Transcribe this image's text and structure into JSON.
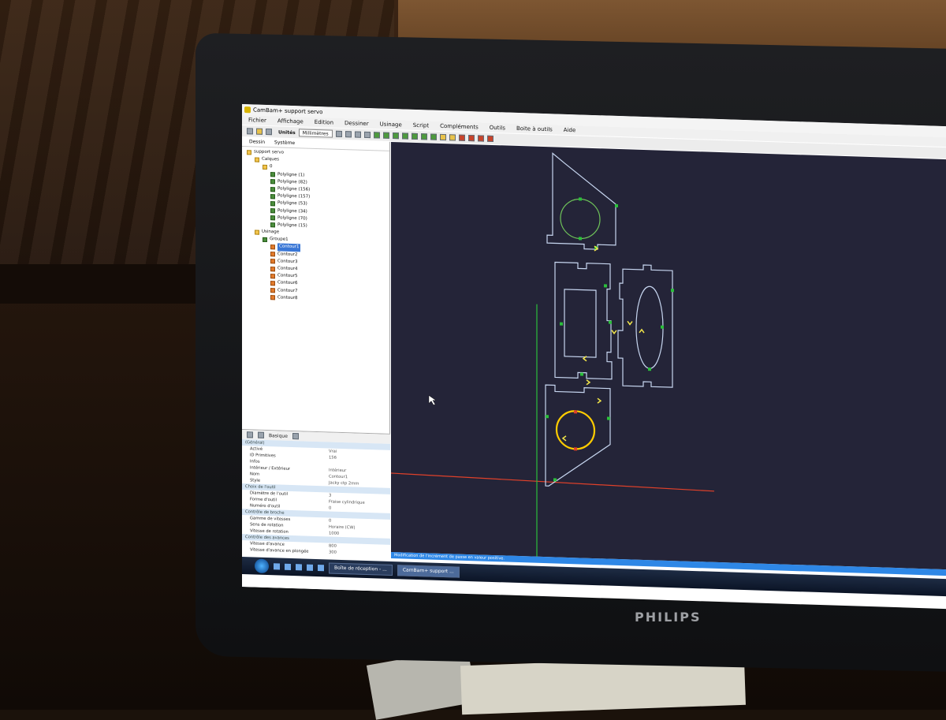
{
  "titlebar": {
    "title": "CamBam+ support servo"
  },
  "menubar": [
    "Fichier",
    "Affichage",
    "Edition",
    "Dessiner",
    "Usinage",
    "Script",
    "Compléments",
    "Outils",
    "Boite à outils",
    "Aide"
  ],
  "toolbar": {
    "units_label": "Unités",
    "units_value": "Millimètres"
  },
  "tabs": [
    "Dessin",
    "Système"
  ],
  "tree": [
    {
      "label": "support servo",
      "icon": "folder-icon",
      "level": 0
    },
    {
      "label": "Calques",
      "icon": "folder-icon",
      "level": 1
    },
    {
      "label": "0",
      "icon": "layer-icon",
      "level": 2
    },
    {
      "label": "Polyligne (1)",
      "icon": "polyline-icon",
      "level": 3
    },
    {
      "label": "Polyligne (82)",
      "icon": "polyline-icon",
      "level": 3
    },
    {
      "label": "Polyligne (156)",
      "icon": "polyline-icon",
      "level": 3
    },
    {
      "label": "Polyligne (157)",
      "icon": "polyline-icon",
      "level": 3
    },
    {
      "label": "Polyligne (53)",
      "icon": "polyline-icon",
      "level": 3
    },
    {
      "label": "Polyligne (34)",
      "icon": "polyline-icon",
      "level": 3
    },
    {
      "label": "Polyligne (70)",
      "icon": "polyline-icon",
      "level": 3
    },
    {
      "label": "Polyligne (15)",
      "icon": "polyline-icon",
      "level": 3
    },
    {
      "label": "Usinage",
      "icon": "folder-icon",
      "level": 1
    },
    {
      "label": "Groupe1",
      "icon": "group-icon",
      "level": 2
    },
    {
      "label": "Contour1",
      "icon": "contour-icon",
      "level": 3,
      "selected": true
    },
    {
      "label": "Contour2",
      "icon": "contour-icon",
      "level": 3
    },
    {
      "label": "Contour3",
      "icon": "contour-icon",
      "level": 3
    },
    {
      "label": "Contour4",
      "icon": "contour-icon",
      "level": 3
    },
    {
      "label": "Contour5",
      "icon": "contour-icon",
      "level": 3
    },
    {
      "label": "Contour6",
      "icon": "contour-icon",
      "level": 3
    },
    {
      "label": "Contour7",
      "icon": "contour-icon",
      "level": 3
    },
    {
      "label": "Contour8",
      "icon": "contour-icon",
      "level": 3
    }
  ],
  "props": {
    "toolbar_label": "Basique",
    "sections": [
      {
        "title": "(Général)",
        "rows": [
          {
            "k": "Activé",
            "v": "Vrai"
          },
          {
            "k": "ID Primitives",
            "v": "156"
          },
          {
            "k": "Infos",
            "v": ""
          },
          {
            "k": "Intérieur / Extérieur",
            "v": "Intérieur"
          },
          {
            "k": "Nom",
            "v": "Contour1"
          },
          {
            "k": "Style",
            "v": "Jacky ctp 2mm"
          }
        ]
      },
      {
        "title": "Choix de l'outil",
        "rows": [
          {
            "k": "Diamètre de l'outil",
            "v": "3"
          },
          {
            "k": "Forme d'outil",
            "v": "Fraise cylindrique"
          },
          {
            "k": "Numéro d'outil",
            "v": "0"
          }
        ]
      },
      {
        "title": "Contrôle de broche",
        "rows": [
          {
            "k": "Gamme de vitesses",
            "v": "0"
          },
          {
            "k": "Sens de rotation",
            "v": "Horaire (CW)"
          },
          {
            "k": "Vitesse de rotation",
            "v": "1000"
          }
        ]
      },
      {
        "title": "Contrôle des avances",
        "rows": [
          {
            "k": "Vitesse d'avance",
            "v": "800"
          },
          {
            "k": "Vitesse d'avance en plongée",
            "v": "300"
          }
        ]
      }
    ]
  },
  "status": {
    "text": "Modification de l'incrément de passe en valeur positive."
  },
  "taskbar": {
    "items": [
      "Boîte de réception - ...",
      "CamBam+ support ..."
    ]
  },
  "brand": {
    "name": "PHILIPS"
  },
  "colors": {
    "canvas_bg": "#242438",
    "part_outline": "#c7d6f0",
    "x_axis": "#e0412a",
    "y_axis": "#2bbf3b",
    "selected": "#ffcc00"
  }
}
